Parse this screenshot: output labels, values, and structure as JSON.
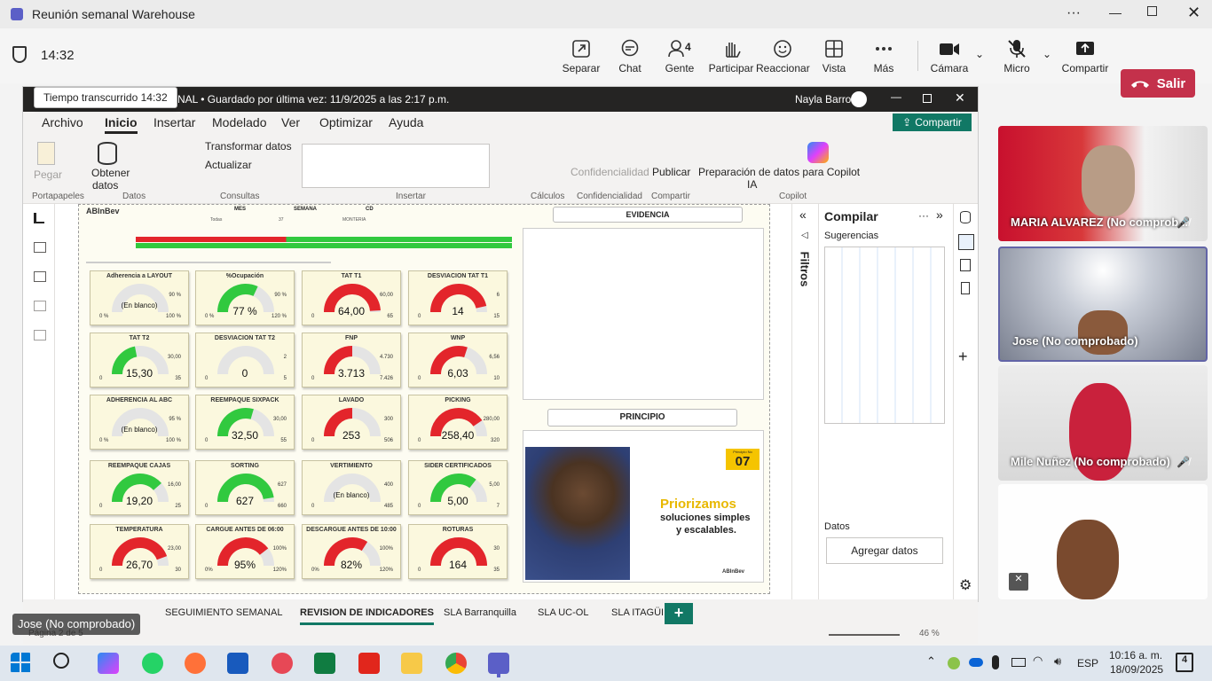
{
  "teams": {
    "window_title": "Reunión semanal Warehouse",
    "timer": "14:32",
    "tooltip": "Tiempo transcurrido 14:32",
    "toolbar": {
      "separar": "Separar",
      "chat": "Chat",
      "gente": "Gente",
      "gente_count": "4",
      "participar": "Participar",
      "reaccionar": "Reaccionar",
      "vista": "Vista",
      "mas": "Más",
      "camara": "Cámara",
      "micro": "Micro",
      "compartir": "Compartir",
      "salir": "Salir"
    },
    "participants": [
      {
        "name": "MARIA ALVAREZ (No comprob..."
      },
      {
        "name": "Jose (No comprobado)"
      },
      {
        "name": "Mile Nuñez (No comprobado)"
      },
      {
        "name": ""
      }
    ],
    "sharer_label": "Jose (No comprobado)"
  },
  "pbi": {
    "title_partial": "NAL • Guardado por última vez: 11/9/2025 a las 2:17 p.m.",
    "user": "Nayla Barros",
    "share": "Compartir",
    "tabs": [
      "Archivo",
      "Inicio",
      "Insertar",
      "Modelado",
      "Ver",
      "Optimizar",
      "Ayuda"
    ],
    "ribbon": {
      "pegar": "Pegar",
      "portapapeles": "Portapapeles",
      "obtener": "Obtener",
      "datos_dd": "datos",
      "datos": "Datos",
      "transformar": "Transformar datos",
      "actualizar": "Actualizar",
      "consultas": "Consultas",
      "insertar": "Insertar",
      "calculos": "Cálculos",
      "confidencialidad": "Confidencialidad",
      "confidencialidad_grp": "Confidencialidad",
      "publicar": "Publicar",
      "compartir_grp": "Compartir",
      "copilot_btn": "Preparación de datos para Copilot",
      "copilot_btn2": "IA",
      "copilot_grp": "Copilot"
    },
    "report": {
      "brand": "ABInBev",
      "filters": [
        "MES",
        "SEMANA",
        "CD"
      ],
      "filter_values": [
        "Todas",
        "37",
        "MONTERIA"
      ],
      "evidencia": "EVIDENCIA",
      "principio": "PRINCIPIO",
      "principio_badge": "07",
      "principio_badge_label": "Principio No",
      "principio_title": "Priorizamos",
      "principio_sub1": "soluciones simples",
      "principio_sub2": "y escalables.",
      "principio_brand": "ABInBev"
    },
    "filtros": "Filtros",
    "viz": {
      "title": "Compilar",
      "sugerencias": "Sugerencias",
      "datos": "Datos",
      "agregar": "Agregar datos"
    },
    "pages": [
      "SEGUIMIENTO SEMANAL",
      "REVISION DE INDICADORES",
      "SLA Barranquilla",
      "SLA UC-OL",
      "SLA ITAGÜI"
    ],
    "status": {
      "page": "Página 2 de 5",
      "zoom": "46 %"
    }
  },
  "kpis": [
    {
      "title": "Adherencia a LAYOUT",
      "value": "(En blanco)",
      "min": "0 %",
      "max": "100 %",
      "target": "90 %",
      "fill": 0
    },
    {
      "title": "%Ocupación",
      "value": "77 %",
      "min": "0 %",
      "max": "120 %",
      "target": "90 %",
      "fill": 0.64
    },
    {
      "title": "TAT T1",
      "value": "64,00",
      "min": "0",
      "max": "65",
      "target": "60,00",
      "fill": 0.98
    },
    {
      "title": "DESVIACION TAT T1",
      "value": "14",
      "min": "0",
      "max": "15",
      "target": "6",
      "fill": 0.93
    },
    {
      "title": "TAT T2",
      "value": "15,30",
      "min": "0",
      "max": "35",
      "target": "30,00",
      "fill": 0.44
    },
    {
      "title": "DESVIACION TAT T2",
      "value": "0",
      "min": "0",
      "max": "5",
      "target": "2",
      "fill": 0
    },
    {
      "title": "FNP",
      "value": "3.713",
      "min": "0",
      "max": "7.426",
      "target": "4.730",
      "fill": 0.5
    },
    {
      "title": "WNP",
      "value": "6,03",
      "min": "0",
      "max": "10",
      "target": "6,56",
      "fill": 0.6
    },
    {
      "title": "ADHERENCIA AL ABC",
      "value": "(En blanco)",
      "min": "0 %",
      "max": "100 %",
      "target": "95 %",
      "fill": 0
    },
    {
      "title": "REEMPAQUE SIXPACK",
      "value": "32,50",
      "min": "0",
      "max": "55",
      "target": "30,00",
      "fill": 0.59
    },
    {
      "title": "LAVADO",
      "value": "253",
      "min": "0",
      "max": "506",
      "target": "300",
      "fill": 0.5
    },
    {
      "title": "PICKING",
      "value": "258,40",
      "min": "0",
      "max": "320",
      "target": "280,00",
      "fill": 0.81
    },
    {
      "title": "REEMPAQUE CAJAS",
      "value": "19,20",
      "min": "0",
      "max": "25",
      "target": "16,00",
      "fill": 0.77
    },
    {
      "title": "SORTING",
      "value": "627",
      "min": "0",
      "max": "660",
      "target": "627",
      "fill": 0.95
    },
    {
      "title": "VERTIMIENTO",
      "value": "(En blanco)",
      "min": "0",
      "max": "485",
      "target": "400",
      "fill": 0
    },
    {
      "title": "SIDER CERTIFICADOS",
      "value": "5,00",
      "min": "0",
      "max": "7",
      "target": "5,00",
      "fill": 0.71
    },
    {
      "title": "TEMPERATURA",
      "value": "26,70",
      "min": "0",
      "max": "30",
      "target": "23,00",
      "fill": 0.89
    },
    {
      "title": "CARGUE ANTES DE 06:00",
      "value": "95%",
      "min": "0%",
      "max": "120%",
      "target": "100%",
      "fill": 0.79
    },
    {
      "title": "DESCARGUE ANTES DE 10:00",
      "value": "82%",
      "min": "0%",
      "max": "120%",
      "target": "100%",
      "fill": 0.68
    },
    {
      "title": "ROTURAS",
      "value": "164",
      "min": "0",
      "max": "35",
      "target": "30",
      "fill": 1
    }
  ],
  "colors": {
    "red": "#e3252b",
    "green": "#31c93f",
    "empty": "#e4e4e4"
  },
  "kpi_colors": [
    "empty",
    "green",
    "red",
    "red",
    "green",
    "empty",
    "red",
    "red",
    "empty",
    "green",
    "red",
    "red",
    "green",
    "green",
    "empty",
    "green",
    "red",
    "red",
    "red",
    "red"
  ],
  "taskbar": {
    "lang": "ESP",
    "time": "10:16 a. m.",
    "date": "18/09/2025",
    "notif": "4"
  }
}
